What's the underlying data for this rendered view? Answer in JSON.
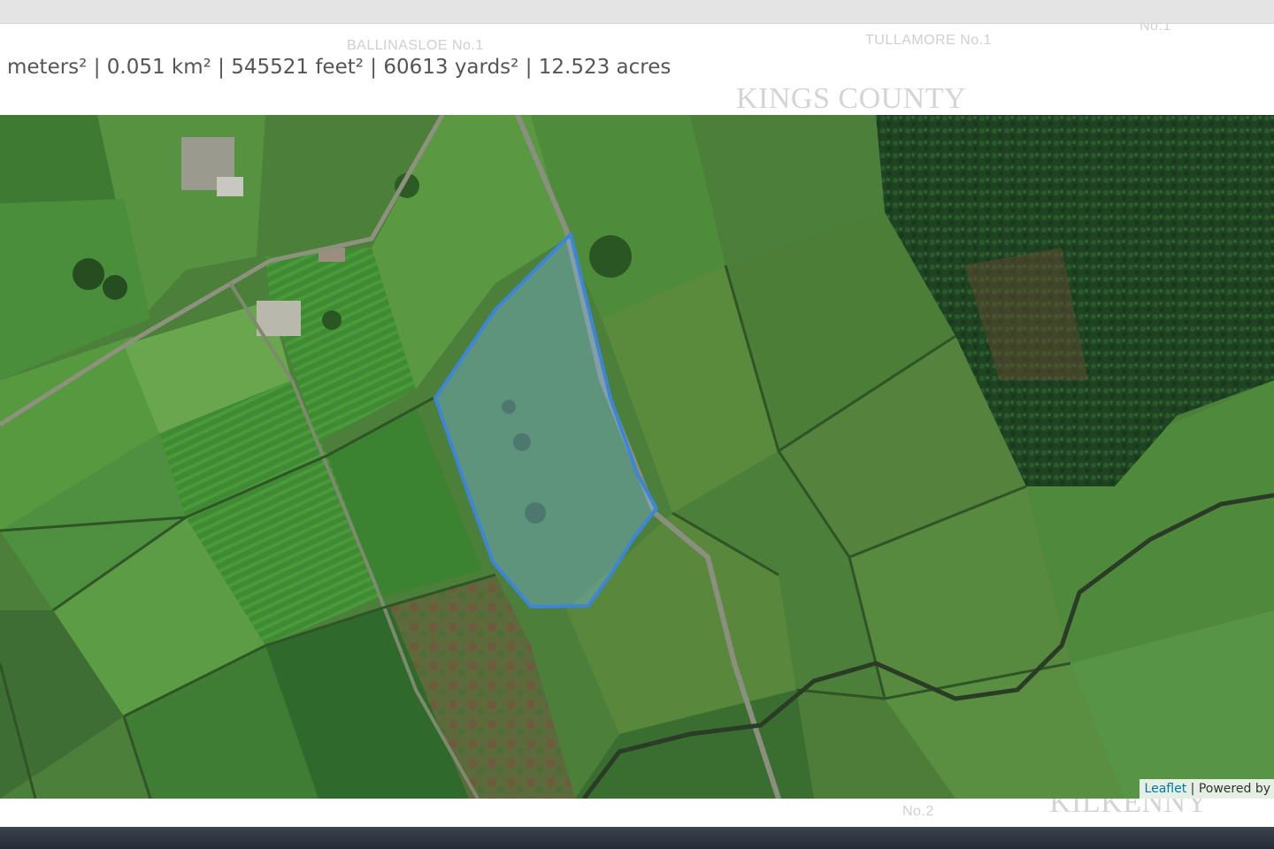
{
  "measurement": {
    "text": "meters² | 0.051 km² | 545521 feet² | 60613 yards² | 12.523 acres"
  },
  "background_labels": {
    "ballinasloe": "BALLINASLOE No.1",
    "tullamore": "TULLAMORE No.1",
    "no_top": "No.1",
    "kings_county": "KINGS COUNTY",
    "no2": "No.2",
    "bottom_county": "KILKENNY"
  },
  "map": {
    "imagery": "satellite",
    "polygon_color": "#3d85d8",
    "attribution": {
      "link_label": "Leaflet",
      "separator": " | ",
      "powered_label": "Powered by"
    }
  }
}
